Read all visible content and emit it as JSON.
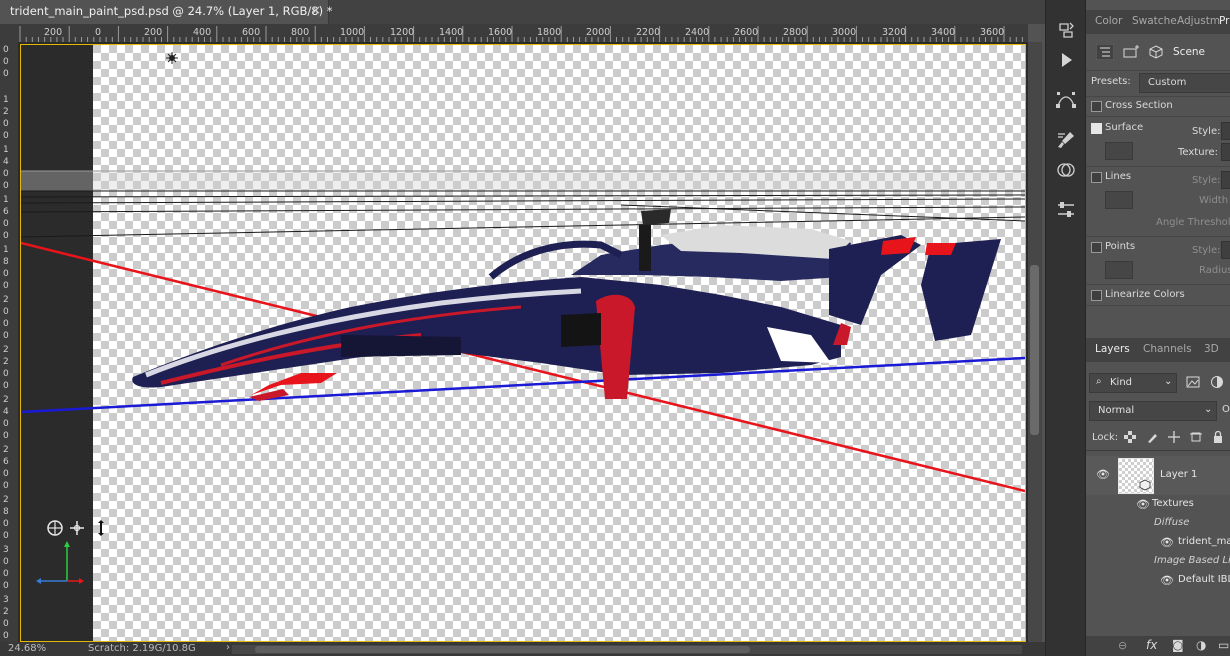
{
  "document": {
    "title": "trident_main_paint_psd.psd @ 24.7% (Layer 1, RGB/8) *",
    "close_glyph": "×"
  },
  "ruler": {
    "h_labels": [
      "200",
      "0",
      "200",
      "400",
      "600",
      "800",
      "1000",
      "1200",
      "1400",
      "1600",
      "1800",
      "2000",
      "2200",
      "2400",
      "2600",
      "2800",
      "3000",
      "3200",
      "3400",
      "3600"
    ],
    "v_labels": [
      "0",
      "0",
      "0",
      "1",
      "2",
      "0",
      "0",
      "1",
      "4",
      "0",
      "0",
      "1",
      "6",
      "0",
      "0",
      "1",
      "8",
      "0",
      "0",
      "2",
      "0",
      "0",
      "0",
      "2",
      "2",
      "0",
      "0",
      "2",
      "4",
      "0",
      "0",
      "2",
      "6",
      "0",
      "0",
      "2",
      "8",
      "0",
      "0",
      "3",
      "0",
      "0",
      "0",
      "3",
      "2",
      "0",
      "0"
    ]
  },
  "status": {
    "zoom": "24.68%",
    "scratch": "Scratch: 2.19G/10.8G",
    "arrow": "›"
  },
  "panel_tabs": {
    "color": "Color",
    "swatches": "Swatche",
    "adjustments": "Adjustm",
    "properties": "Pr"
  },
  "properties": {
    "scene_label": "Scene",
    "presets_label": "Presets:",
    "presets_value": "Custom",
    "cross_section": "Cross Section",
    "surface": "Surface",
    "surface_style": "Style:",
    "surface_texture": "Texture:",
    "lines": "Lines",
    "lines_style": "Style:",
    "lines_width": "Width",
    "angle_threshold": "Angle Threshold",
    "points": "Points",
    "points_style": "Style:",
    "points_radius": "Radius",
    "linearize_colors": "Linearize Colors",
    "surface_checked": true
  },
  "layers_panel": {
    "tabs": [
      "Layers",
      "Channels",
      "3D"
    ],
    "filter_kind": "Kind",
    "blend_mode": "Normal",
    "opacity_label": "O",
    "lock_label": "Lock:",
    "layer_name": "Layer 1",
    "textures": "Textures",
    "diffuse": "Diffuse",
    "diffuse_file": "trident_mai",
    "ibl": "Image Based Lig",
    "default_ibl": "Default IBL"
  },
  "colors": {
    "axis_red": "#e8141c",
    "axis_blue": "#1a1ad6",
    "car_navy": "#1e1f52",
    "car_red": "#c8182a",
    "canvas_border": "#e6b800"
  }
}
